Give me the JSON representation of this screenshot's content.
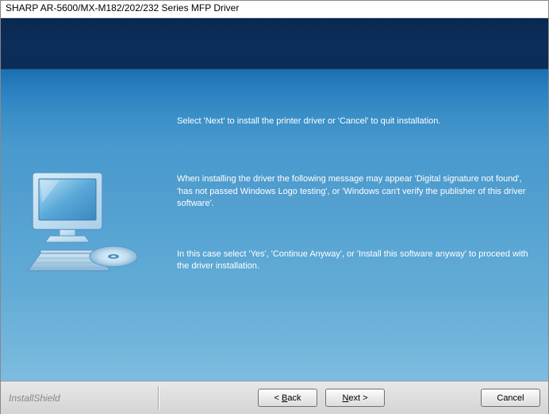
{
  "window": {
    "title": "SHARP AR-5600/MX-M182/202/232 Series MFP Driver"
  },
  "content": {
    "intro_text": "Select 'Next' to install the printer driver or 'Cancel' to quit installation.",
    "warning_text": "When installing the driver the following message may appear 'Digital signature not found', 'has not passed Windows Logo testing', or 'Windows can't verify the publisher of this driver software'.",
    "proceed_text": "In this case select 'Yes', 'Continue Anyway', or 'Install this software anyway' to proceed with the driver installation."
  },
  "footer": {
    "brand": "InstallShield",
    "back_label": "Back",
    "next_label": "Next",
    "cancel_label": "Cancel"
  }
}
